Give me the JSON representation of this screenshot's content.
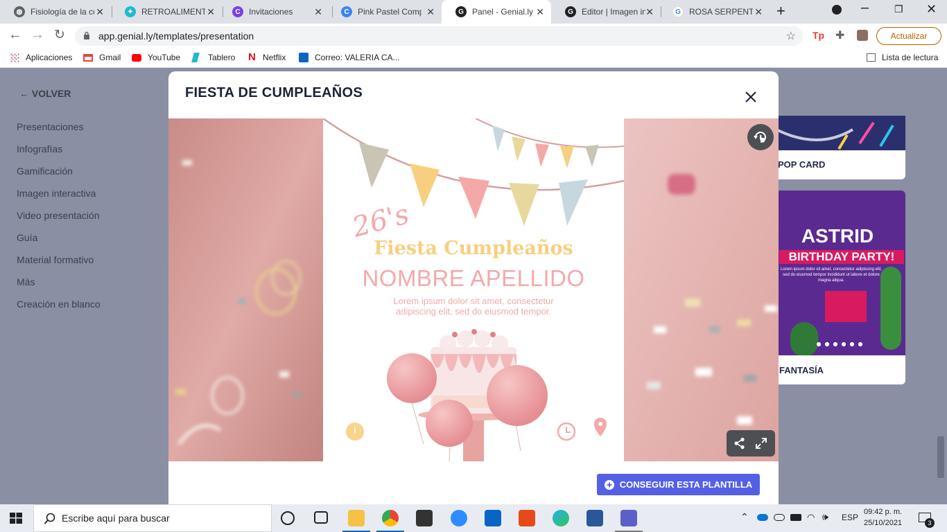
{
  "tabs": [
    {
      "title": "Fisiología de la co",
      "color": "#5f6368"
    },
    {
      "title": "RETROALIMENTA",
      "color": "#22b8cf"
    },
    {
      "title": "Invitaciones",
      "color": "#7b3fe4"
    },
    {
      "title": "Pink Pastel Comp",
      "color": "#3b82f6"
    },
    {
      "title": "Panel - Genial.ly",
      "color": "#202124"
    },
    {
      "title": "Editor | Imagen in",
      "color": "#202124"
    },
    {
      "title": "ROSA SERPENTIN",
      "color": "#4285f4"
    }
  ],
  "toolbar": {
    "url": "app.genial.ly/templates/presentation",
    "update_label": "Actualizar"
  },
  "bookmarks": [
    {
      "label": "Aplicaciones",
      "icon": "apps-icon"
    },
    {
      "label": "Gmail",
      "icon": "gmail-icon"
    },
    {
      "label": "YouTube",
      "icon": "youtube-icon"
    },
    {
      "label": "Tablero",
      "icon": "tablero-icon"
    },
    {
      "label": "Netflix",
      "icon": "netflix-icon"
    },
    {
      "label": "Correo: VALERIA CA...",
      "icon": "outlook-icon"
    }
  ],
  "reading_list": "Lista de lectura",
  "sidebar": {
    "back": "VOLVER",
    "items": [
      "Presentaciones",
      "Infografías",
      "Gamificación",
      "Imagen interactiva",
      "Video presentación",
      "Guía",
      "Material formativo",
      "Más",
      "Creación en blanco"
    ]
  },
  "cards": [
    {
      "label": "POP CARD"
    },
    {
      "label": "FANTASÍA",
      "headline": "ASTRID",
      "subheadline": "BIRTHDAY PARTY!",
      "body": "Lorem ipsum dolor sit amet, consectetur adipiscing elit, sed do eiusmod tempor incididunt ut labore et dolore magna aliqua."
    }
  ],
  "modal": {
    "title": "FIESTA DE CUMPLEAÑOS",
    "cta": "CONSEGUIR ESTA PLANTILLA",
    "slide": {
      "age": "26's",
      "title": "Fiesta Cumpleaños",
      "name": "NOMBRE APELLIDO",
      "body1": "Lorem ipsum dolor sit amet, consectetur",
      "body2": "adipiscing elit, sed do eiusmod tempor.",
      "info_icon": "i"
    }
  },
  "taskbar": {
    "search_placeholder": "Escribe aquí para buscar",
    "lang": "ESP",
    "time": "09:42 p. m.",
    "date": "25/10/2021",
    "notifications": "3"
  },
  "colors": {
    "accent": "#5460e4",
    "page_overlay": "#8a8fa3",
    "slide_pink": "#f4a9a8",
    "slide_gold": "#f7cf7e"
  }
}
